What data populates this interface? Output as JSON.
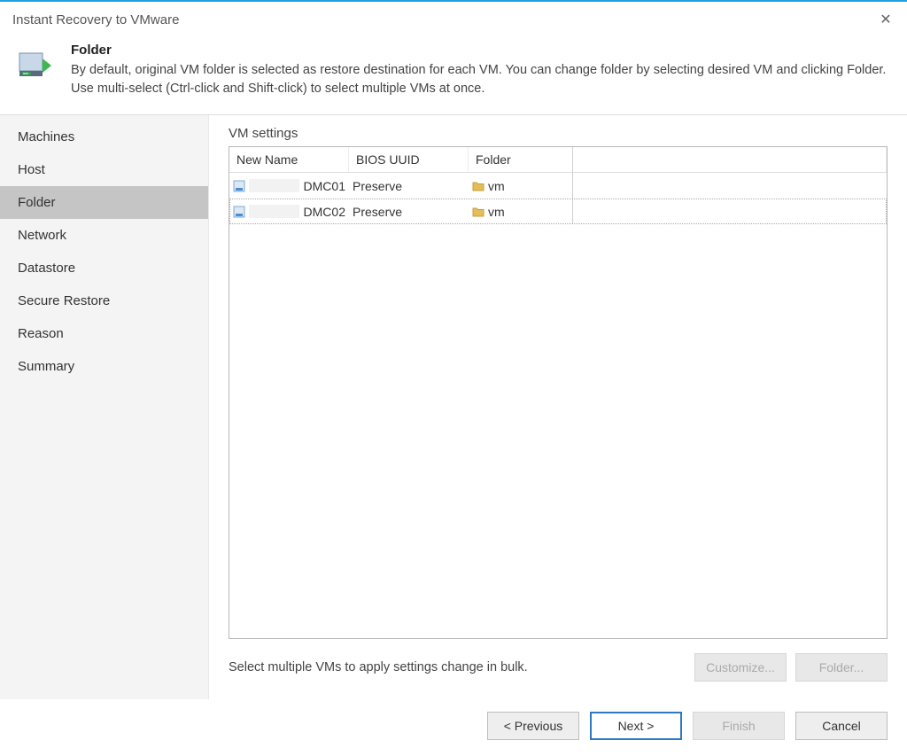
{
  "window": {
    "title": "Instant Recovery to VMware"
  },
  "header": {
    "title": "Folder",
    "description": "By default, original VM folder is selected as restore destination for each VM. You can change folder by selecting desired VM and clicking Folder. Use multi-select (Ctrl-click and Shift-click) to select multiple VMs at once."
  },
  "sidebar": {
    "items": [
      {
        "label": "Machines",
        "active": false
      },
      {
        "label": "Host",
        "active": false
      },
      {
        "label": "Folder",
        "active": true
      },
      {
        "label": "Network",
        "active": false
      },
      {
        "label": "Datastore",
        "active": false
      },
      {
        "label": "Secure Restore",
        "active": false
      },
      {
        "label": "Reason",
        "active": false
      },
      {
        "label": "Summary",
        "active": false
      }
    ]
  },
  "main": {
    "section_label": "VM settings",
    "columns": {
      "name": "New Name",
      "bios": "BIOS UUID",
      "folder": "Folder"
    },
    "rows": [
      {
        "name_suffix": "DMC01",
        "bios": "Preserve",
        "folder": "vm"
      },
      {
        "name_suffix": "DMC02",
        "bios": "Preserve",
        "folder": "vm"
      }
    ],
    "hint": "Select multiple VMs to apply settings change in bulk.",
    "buttons": {
      "customize": "Customize...",
      "folder": "Folder..."
    }
  },
  "footer": {
    "previous": "< Previous",
    "next": "Next >",
    "finish": "Finish",
    "cancel": "Cancel"
  }
}
